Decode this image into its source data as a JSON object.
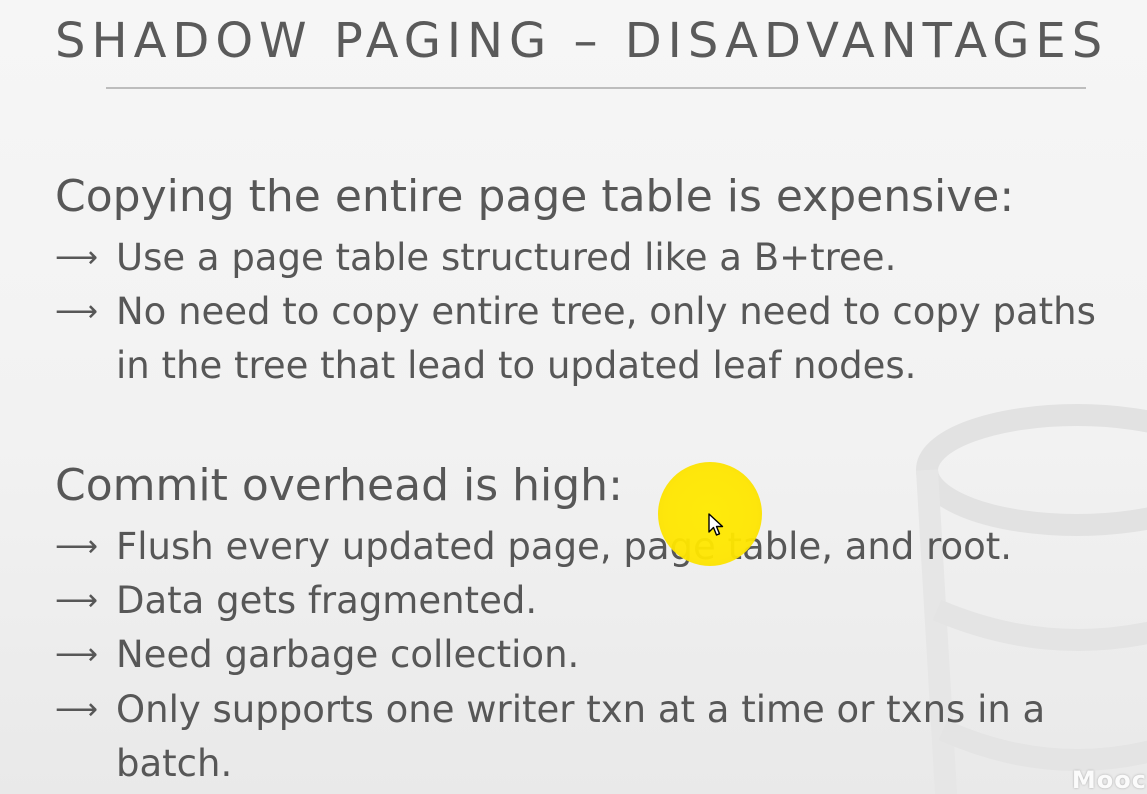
{
  "slide": {
    "title": "SHADOW PAGING – DISADVANTAGES",
    "sections": [
      {
        "heading": "Copying the entire page table is expensive:",
        "bullets": [
          "Use a page table structured like a B+tree.",
          "No need to copy entire tree, only need to copy paths in the tree that lead to updated leaf nodes."
        ]
      },
      {
        "heading": "Commit overhead is high:",
        "bullets": [
          "Flush every updated page,  page table, and root.",
          "Data gets fragmented.",
          "Need garbage collection.",
          "Only supports one writer txn at a time or txns in a batch."
        ]
      }
    ],
    "arrow_glyph": "⟶"
  },
  "overlay": {
    "watermark_text": "Mooc",
    "highlight_color": "#ffe600",
    "pointer_icon": "mouse-pointer-icon"
  }
}
